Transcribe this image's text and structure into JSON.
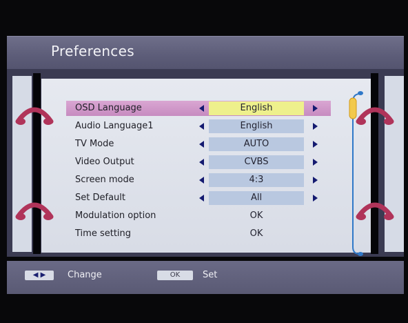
{
  "title": "Preferences",
  "menu": [
    {
      "label": "OSD Language",
      "value": "English",
      "type": "select",
      "selected": true
    },
    {
      "label": "Audio Language1",
      "value": "English",
      "type": "select",
      "selected": false
    },
    {
      "label": "TV Mode",
      "value": "AUTO",
      "type": "select",
      "selected": false
    },
    {
      "label": "Video Output",
      "value": "CVBS",
      "type": "select",
      "selected": false
    },
    {
      "label": "Screen mode",
      "value": "4:3",
      "type": "select",
      "selected": false
    },
    {
      "label": "Set Default",
      "value": "All",
      "type": "select",
      "selected": false
    },
    {
      "label": "Modulation option",
      "value": "OK",
      "type": "action",
      "selected": false
    },
    {
      "label": "Time setting",
      "value": "OK",
      "type": "action",
      "selected": false
    }
  ],
  "help": {
    "change_label": "Change",
    "ok_key": "OK",
    "set_label": "Set"
  },
  "colors": {
    "selected_row": "#c78bc0",
    "selected_value": "#eef08c",
    "value_box": "#b9c8e0",
    "arrow": "#141a70",
    "handle": "#b0345a",
    "scrollbar": "#2f78c8",
    "scroll_thumb": "#f2c94c"
  },
  "icons": {
    "arrow_left": "left-arrow-icon",
    "arrow_right": "right-arrow-icon",
    "handle": "phone-handle-icon"
  }
}
